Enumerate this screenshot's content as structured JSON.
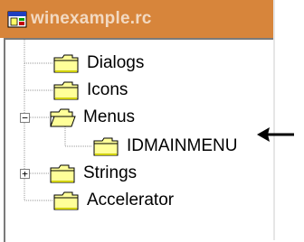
{
  "window": {
    "title": "winexample.rc",
    "title_color": "#f2d9c1",
    "titlebar_color": "#d7853b"
  },
  "tree": {
    "items": [
      {
        "label": "Dialogs",
        "icon": "folder-closed-icon",
        "level": 1
      },
      {
        "label": "Icons",
        "icon": "folder-closed-icon",
        "level": 1
      },
      {
        "label": "Menus",
        "icon": "folder-open-icon",
        "level": 1,
        "expanded": true,
        "expander": "−"
      },
      {
        "label": "IDMAINMENU",
        "icon": "folder-closed-icon",
        "level": 2
      },
      {
        "label": "Strings",
        "icon": "folder-closed-icon",
        "level": 1,
        "expanded": false,
        "expander": "+"
      },
      {
        "label": "Accelerator",
        "icon": "folder-closed-icon",
        "level": 1
      }
    ]
  },
  "colors": {
    "folder_fill": "#ffff99",
    "folder_shadow": "#cfcf00",
    "tree_line": "#9a9a9a"
  }
}
